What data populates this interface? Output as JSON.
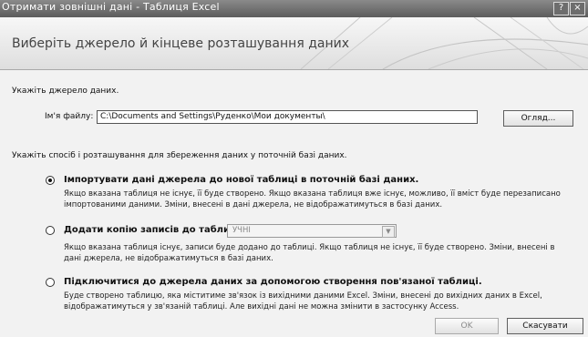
{
  "window": {
    "title": "Отримати зовнішні дані - Таблиця Excel",
    "help_glyph": "?",
    "close_glyph": "×"
  },
  "banner": {
    "heading": "Виберіть джерело й кінцеве розташування даних"
  },
  "source": {
    "label": "Укажіть джерело даних.",
    "file_label": "Ім'я файлу:",
    "file_value": "C:\\Documents and Settings\\Руденко\\Мои документы\\",
    "browse_label": "Огляд..."
  },
  "storage": {
    "label": "Укажіть спосіб і розташування для збереження даних у поточній базі даних.",
    "options": [
      {
        "title": "Імпортувати дані джерела до нової таблиці в поточній базі даних.",
        "checked": true,
        "description": "Якщо вказана таблиця не існує, її буде створено. Якщо вказана таблиця вже існує, можливо, її вміст буде перезаписано імпортованими даними. Зміни, внесені в дані джерела, не відображатимуться в базі даних."
      },
      {
        "title": "Додати копію записів до таблиці:",
        "checked": false,
        "table_value": "УЧНІ",
        "description": "Якщо вказана таблиця існує, записи буде додано до таблиці. Якщо таблиця не існує, її буде створено. Зміни, внесені в дані джерела, не відображатимуться в базі даних."
      },
      {
        "title": "Підключитися до джерела даних за допомогою створення пов'язаної таблиці.",
        "checked": false,
        "description": "Буде створено таблицю, яка міститиме зв'язок із вихідними даними Excel. Зміни, внесені до вихідних даних в Excel, відображатимуться у зв'язаній таблиці. Але вихідні дані не можна змінити в застосунку Access."
      }
    ]
  },
  "footer": {
    "ok_label": "OK",
    "cancel_label": "Скасувати"
  }
}
